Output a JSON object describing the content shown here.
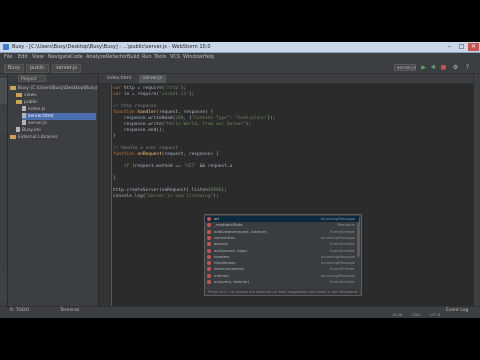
{
  "window": {
    "title": "Busy - [C:\\Users\\Busy\\Desktop\\Busy\\Busy] - ...\\public\\server.js - WebStorm 10.0",
    "controls": [
      "–",
      "□",
      "✕"
    ]
  },
  "menu": [
    "File",
    "Edit",
    "View",
    "Navigate",
    "Code",
    "Analyze",
    "Refactor",
    "Build",
    "Run",
    "Tools",
    "VCS",
    "Window",
    "Help"
  ],
  "toolbar": {
    "breadcrumbs": [
      "Busy",
      "public",
      "server.js"
    ],
    "run_config": "server.js"
  },
  "project": {
    "selector": "Project",
    "tree": [
      {
        "label": "Busy (C:\\Users\\Busy\\Desktop\\Busy)",
        "kind": "folder",
        "indent": 0
      },
      {
        "label": "views",
        "kind": "folder",
        "indent": 1
      },
      {
        "label": "public",
        "kind": "folder",
        "indent": 1
      },
      {
        "label": "index.js",
        "kind": "file",
        "indent": 2
      },
      {
        "label": "server.html",
        "kind": "file",
        "indent": 2,
        "selected": true
      },
      {
        "label": "server.js",
        "kind": "file",
        "indent": 2
      },
      {
        "label": "Busy.iml",
        "kind": "file",
        "indent": 1
      },
      {
        "label": "External Libraries",
        "kind": "folder",
        "indent": 0
      }
    ]
  },
  "editor": {
    "tabs": [
      {
        "label": "index.html",
        "active": false
      },
      {
        "label": "server.js",
        "active": true
      }
    ],
    "code_lines": [
      {
        "n": 1,
        "html": "<span class='kw'>var</span> http = require(<span class='str'>'http'</span>);"
      },
      {
        "n": 2,
        "html": "<span class='kw'>var</span> io = require(<span class='str'>'socket.io'</span>);"
      },
      {
        "n": 3,
        "html": ""
      },
      {
        "n": 4,
        "html": "<span class='cm'>// http response</span>"
      },
      {
        "n": 5,
        "html": "<span class='kw'>function</span> <span class='fn'>handler</span>(request, response) {"
      },
      {
        "n": 6,
        "html": "    response.writeHead(<span class='str'>200</span>, {<span class='str'>\"Content-Type\"</span>: <span class='str'>\"text/plain\"</span>});"
      },
      {
        "n": 7,
        "html": "    response.write(<span class='str'>\"Hello World, from our Server\"</span>);"
      },
      {
        "n": 8,
        "html": "    response.end();"
      },
      {
        "n": 9,
        "html": "}"
      },
      {
        "n": 10,
        "html": ""
      },
      {
        "n": 11,
        "html": "<span class='cm'>// Handle a user request</span>"
      },
      {
        "n": 12,
        "html": "<span class='kw'>function</span> <span class='fn'>onRequest</span>(request, response) {"
      },
      {
        "n": 13,
        "html": ""
      },
      {
        "n": 14,
        "html": "    <span class='kw'>if</span> (request.method == <span class='str'>'GET'</span> && request.u"
      },
      {
        "n": 15,
        "html": ""
      },
      {
        "n": 16,
        "html": "}"
      },
      {
        "n": 17,
        "html": ""
      },
      {
        "n": 18,
        "html": "http.createServer(onRequest).listen(<span class='str'>8888</span>);"
      },
      {
        "n": 19,
        "html": "console.log(<span class='str'>\"Server is now listening\"</span>);"
      }
    ]
  },
  "autocomplete": {
    "items": [
      {
        "text": "url",
        "type": "IncomingMessage"
      },
      {
        "text": "_readableState",
        "type": "Readable"
      },
      {
        "text": "addListener(event, listener)",
        "type": "EventEmitter"
      },
      {
        "text": "connection",
        "type": "IncomingMessage"
      },
      {
        "text": "domain",
        "type": "EventEmitter"
      },
      {
        "text": "emit(event, args)",
        "type": "EventEmitter"
      },
      {
        "text": "headers",
        "type": "IncomingMessage"
      },
      {
        "text": "httpVersion",
        "type": "IncomingMessage"
      },
      {
        "text": "listeners(event)",
        "type": "EventEmitter"
      },
      {
        "text": "method",
        "type": "IncomingMessage"
      },
      {
        "text": "on(event, listener)",
        "type": "EventEmitter"
      }
    ],
    "hint": "Press Ctrl+. to choose the selected (or first) suggestion and insert a dot afterwards"
  },
  "bottom_tools": [
    "6: TODO",
    "Terminal"
  ],
  "status": {
    "event_log": "Event Log",
    "position": "14:46",
    "line_sep": "CRLF",
    "encoding": "UTF-8"
  }
}
